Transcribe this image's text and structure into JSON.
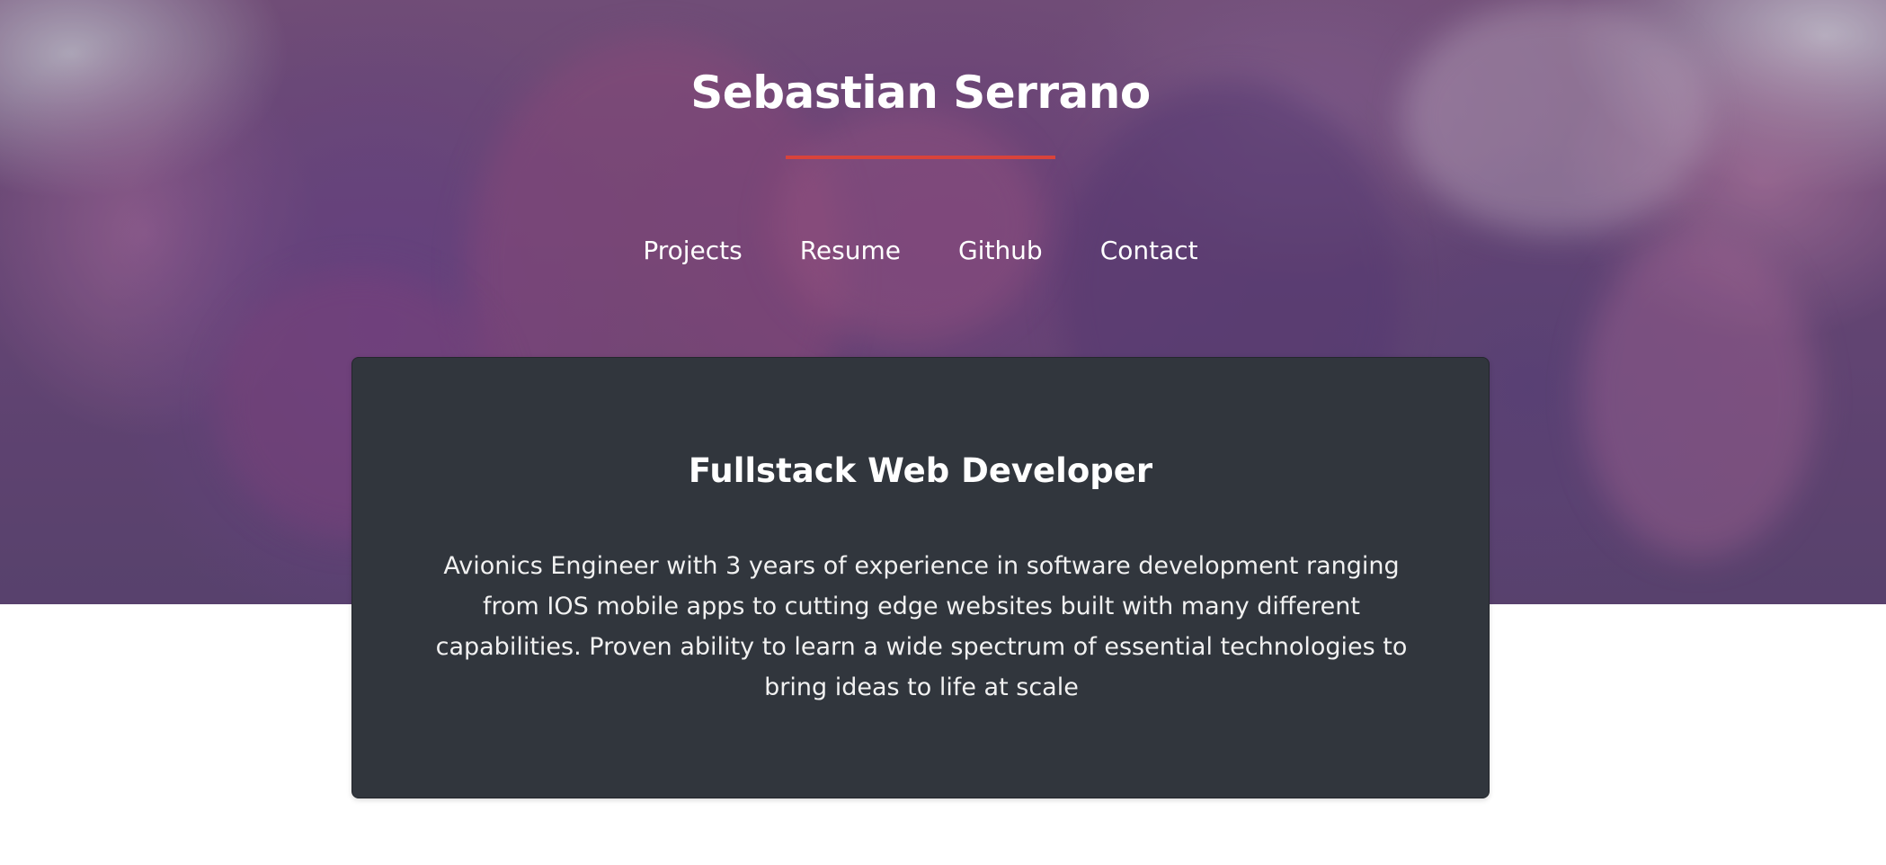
{
  "header": {
    "name": "Sebastian Serrano",
    "accent_color": "#d9433b"
  },
  "nav": {
    "items": [
      {
        "label": "Projects"
      },
      {
        "label": "Resume"
      },
      {
        "label": "Github"
      },
      {
        "label": "Contact"
      }
    ]
  },
  "intro_card": {
    "title": "Fullstack Web Developer",
    "description": "Avionics Engineer with 3 years of experience in software development ranging from IOS mobile apps to cutting edge websites built with many different capabilities. Proven ability to learn a wide spectrum of essential technologies to bring ideas to life at scale",
    "background_color": "#31363d"
  }
}
